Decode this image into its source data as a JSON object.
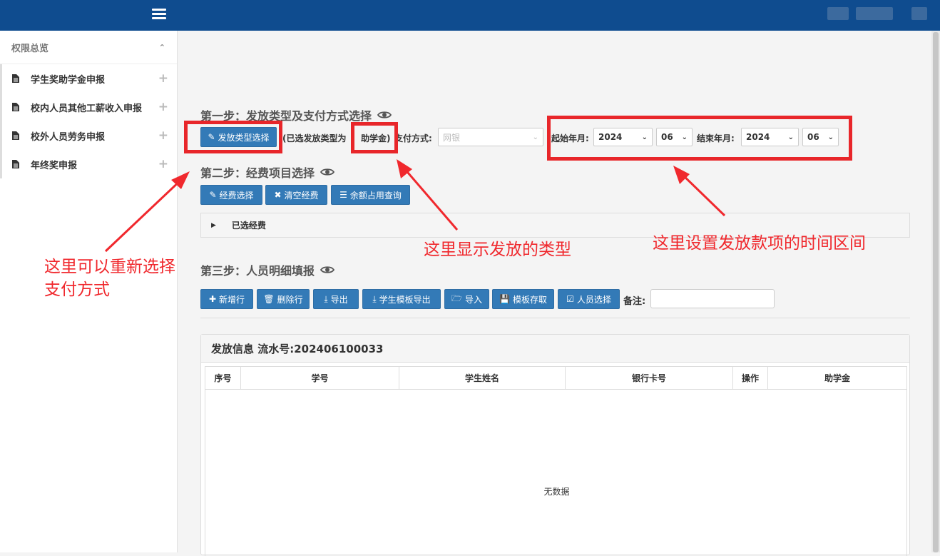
{
  "sidebar": {
    "header": "权限总览",
    "items": [
      {
        "label": "学生奖助学金申报"
      },
      {
        "label": "校内人员其他工薪收入申报"
      },
      {
        "label": "校外人员劳务申报"
      },
      {
        "label": "年终奖申报"
      }
    ]
  },
  "step1": {
    "title": "第一步：发放类型及支付方式选择",
    "type_button": "发放类型选择",
    "selected_prefix": "(已选发放类型为",
    "selected_value": "助学金)",
    "payment_label": "支付方式:",
    "payment_value": "网银",
    "start_label": "起始年月:",
    "start_year": "2024",
    "start_month": "06",
    "end_label": "结束年月:",
    "end_year": "2024",
    "end_month": "06"
  },
  "step2": {
    "title": "第二步：经费项目选择",
    "buttons": [
      "经费选择",
      "清空经费",
      "余额占用查询"
    ],
    "selected_panel": "已选经费"
  },
  "step3": {
    "title": "第三步：人员明细填报",
    "buttons": [
      "新增行",
      "删除行",
      "导出",
      "学生模板导出",
      "导入",
      "模板存取",
      "人员选择"
    ],
    "note_label": "备注:"
  },
  "info": {
    "title": "发放信息 流水号:202406100033",
    "columns": [
      "序号",
      "学号",
      "学生姓名",
      "银行卡号",
      "操作",
      "助学金"
    ],
    "empty_text": "无数据"
  },
  "annotations": {
    "left": [
      "这里可以重新选择",
      "支付方式"
    ],
    "middle": "这里显示发放的类型",
    "right": "这里设置发放款项的时间区间",
    "color": "#e8262a"
  },
  "colors": {
    "topbar": "#0f4c8f",
    "button": "#337ab7"
  }
}
